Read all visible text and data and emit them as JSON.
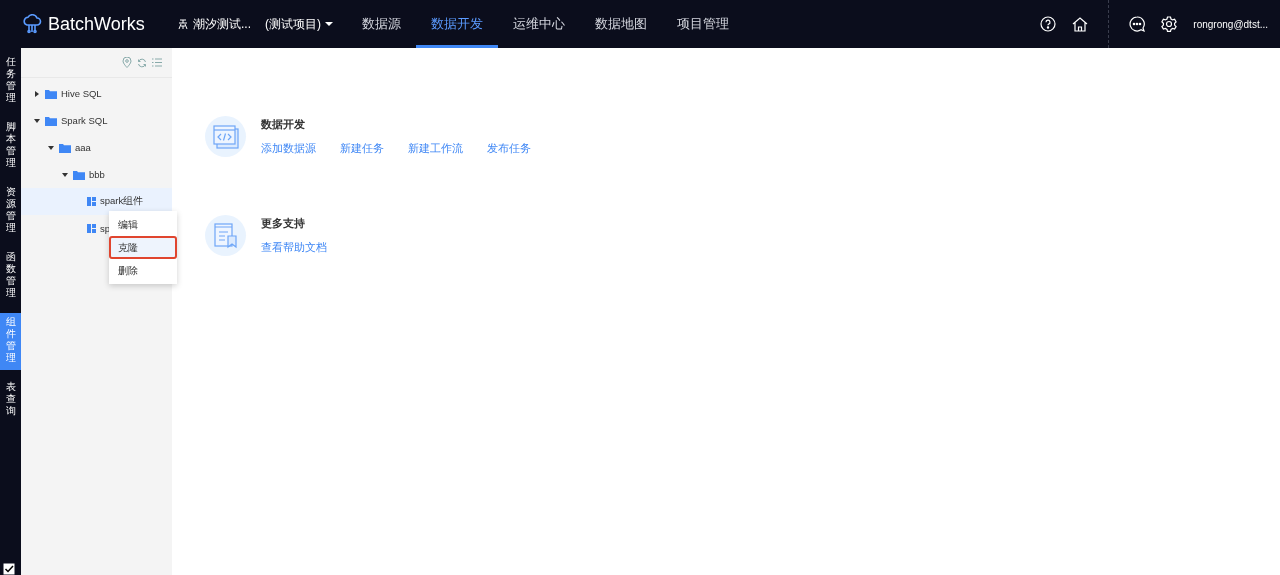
{
  "header": {
    "brand": "BatchWorks",
    "project": "潮汐测试...",
    "project_tag": "(测试项目)",
    "nav": [
      {
        "label": "数据源",
        "selected": false
      },
      {
        "label": "数据开发",
        "selected": true
      },
      {
        "label": "运维中心",
        "selected": false
      },
      {
        "label": "数据地图",
        "selected": false
      },
      {
        "label": "项目管理",
        "selected": false
      }
    ],
    "user": "rongrong@dtst..."
  },
  "side_nav": [
    {
      "label": "任务管理",
      "selected": false
    },
    {
      "label": "脚本管理",
      "selected": false
    },
    {
      "label": "资源管理",
      "selected": false
    },
    {
      "label": "函数管理",
      "selected": false
    },
    {
      "label": "组件管理",
      "selected": true
    },
    {
      "label": "表查询",
      "selected": false
    }
  ],
  "tree": [
    {
      "kind": "folder",
      "label": "Hive SQL",
      "expanded": false
    },
    {
      "kind": "folder",
      "label": "Spark SQL",
      "expanded": true,
      "children": [
        {
          "kind": "folder",
          "label": "aaa",
          "expanded": true,
          "children": [
            {
              "kind": "folder",
              "label": "bbb",
              "expanded": true,
              "children": [
                {
                  "kind": "component",
                  "label": "spark组件",
                  "selected": true
                },
                {
                  "kind": "component",
                  "label": "sp",
                  "selected": false
                }
              ]
            }
          ]
        }
      ]
    }
  ],
  "context_menu": [
    {
      "label": "编辑",
      "selected": false
    },
    {
      "label": "克隆",
      "selected": true
    },
    {
      "label": "删除",
      "selected": false
    }
  ],
  "sections": [
    {
      "kind": "code",
      "title": "数据开发",
      "links": [
        "添加数据源",
        "新建任务",
        "新建工作流",
        "发布任务"
      ]
    },
    {
      "kind": "doc",
      "title": "更多支持",
      "links": [
        "查看帮助文档"
      ]
    }
  ]
}
